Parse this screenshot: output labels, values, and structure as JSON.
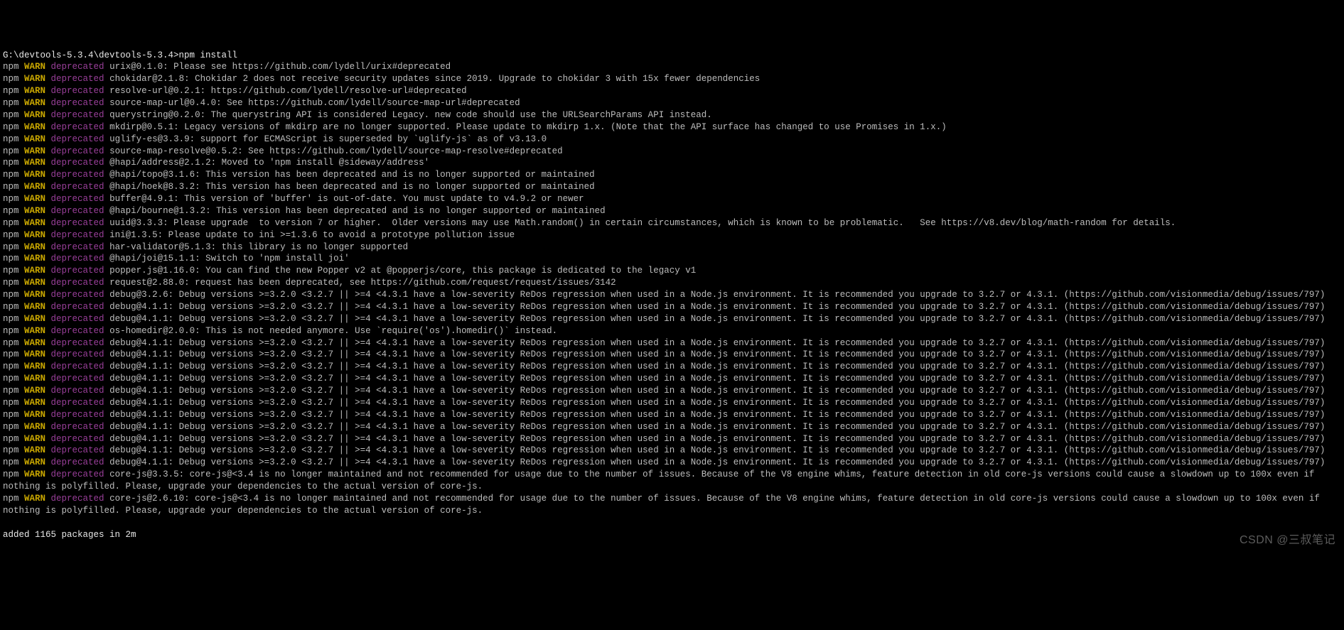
{
  "prompt": "G:\\devtools-5.3.4\\devtools-5.3.4>npm install",
  "npm": "npm",
  "warn": "WARN",
  "dep": "deprecated",
  "lines": [
    {
      "pkg": "urix@0.1.0",
      "msg": "Please see https://github.com/lydell/urix#deprecated"
    },
    {
      "pkg": "chokidar@2.1.8",
      "msg": "Chokidar 2 does not receive security updates since 2019. Upgrade to chokidar 3 with 15x fewer dependencies"
    },
    {
      "pkg": "resolve-url@0.2.1",
      "msg": "https://github.com/lydell/resolve-url#deprecated"
    },
    {
      "pkg": "source-map-url@0.4.0",
      "msg": "See https://github.com/lydell/source-map-url#deprecated"
    },
    {
      "pkg": "querystring@0.2.0",
      "msg": "The querystring API is considered Legacy. new code should use the URLSearchParams API instead."
    },
    {
      "pkg": "mkdirp@0.5.1",
      "msg": "Legacy versions of mkdirp are no longer supported. Please update to mkdirp 1.x. (Note that the API surface has changed to use Promises in 1.x.)"
    },
    {
      "pkg": "uglify-es@3.3.9",
      "msg": "support for ECMAScript is superseded by `uglify-js` as of v3.13.0"
    },
    {
      "pkg": "source-map-resolve@0.5.2",
      "msg": "See https://github.com/lydell/source-map-resolve#deprecated"
    },
    {
      "pkg": "@hapi/address@2.1.2",
      "msg": "Moved to 'npm install @sideway/address'"
    },
    {
      "pkg": "@hapi/topo@3.1.6",
      "msg": "This version has been deprecated and is no longer supported or maintained"
    },
    {
      "pkg": "@hapi/hoek@8.3.2",
      "msg": "This version has been deprecated and is no longer supported or maintained"
    },
    {
      "pkg": "buffer@4.9.1",
      "msg": "This version of 'buffer' is out-of-date. You must update to v4.9.2 or newer"
    },
    {
      "pkg": "@hapi/bourne@1.3.2",
      "msg": "This version has been deprecated and is no longer supported or maintained"
    },
    {
      "pkg": "uuid@3.3.3",
      "msg": "Please upgrade  to version 7 or higher.  Older versions may use Math.random() in certain circumstances, which is known to be problematic.   See https://v8.dev/blog/math-random for details."
    },
    {
      "pkg": "ini@1.3.5",
      "msg": "Please update to ini >=1.3.6 to avoid a prototype pollution issue"
    },
    {
      "pkg": "har-validator@5.1.3",
      "msg": "this library is no longer supported"
    },
    {
      "pkg": "@hapi/joi@15.1.1",
      "msg": "Switch to 'npm install joi'"
    },
    {
      "pkg": "popper.js@1.16.0",
      "msg": "You can find the new Popper v2 at @popperjs/core, this package is dedicated to the legacy v1"
    },
    {
      "pkg": "request@2.88.0",
      "msg": "request has been deprecated, see https://github.com/request/request/issues/3142"
    }
  ],
  "debug326": {
    "pkg": "debug@3.2.6",
    "msg": "Debug versions >=3.2.0 <3.2.7 || >=4 <4.3.1 have a low-severity ReDos regression when used in a Node.js environment. It is recommended you upgrade to 3.2.7 or 4.3.1. (https://github.com/visionmedia/debug/issues/797)"
  },
  "debug411": {
    "pkg": "debug@4.1.1",
    "msg": "Debug versions >=3.2.0 <3.2.7 || >=4 <4.3.1 have a low-severity ReDos regression when used in a Node.js environment. It is recommended you upgrade to 3.2.7 or 4.3.1. (https://github.com/visionmedia/debug/issues/797)"
  },
  "oshomedir": {
    "pkg": "os-homedir@2.0.0",
    "msg": "This is not needed anymore. Use `require('os').homedir()` instead."
  },
  "corejs335": {
    "pkg": "core-js@3.3.5",
    "msg": "core-js@<3.4 is no longer maintained and not recommended for usage due to the number of issues. Because of the V8 engine whims, feature detection in old core-js versions could cause a slowdown up to 100x even if nothing is polyfilled. Please, upgrade your dependencies to the actual version of core-js."
  },
  "corejs2610": {
    "pkg": "core-js@2.6.10",
    "msg": "core-js@<3.4 is no longer maintained and not recommended for usage due to the number of issues. Because of the V8 engine whims, feature detection in old core-js versions could cause a slowdown up to 100x even if nothing is polyfilled. Please, upgrade your dependencies to the actual version of core-js."
  },
  "added": "added 1165 packages in 2m",
  "watermark": "CSDN @三叔笔记"
}
